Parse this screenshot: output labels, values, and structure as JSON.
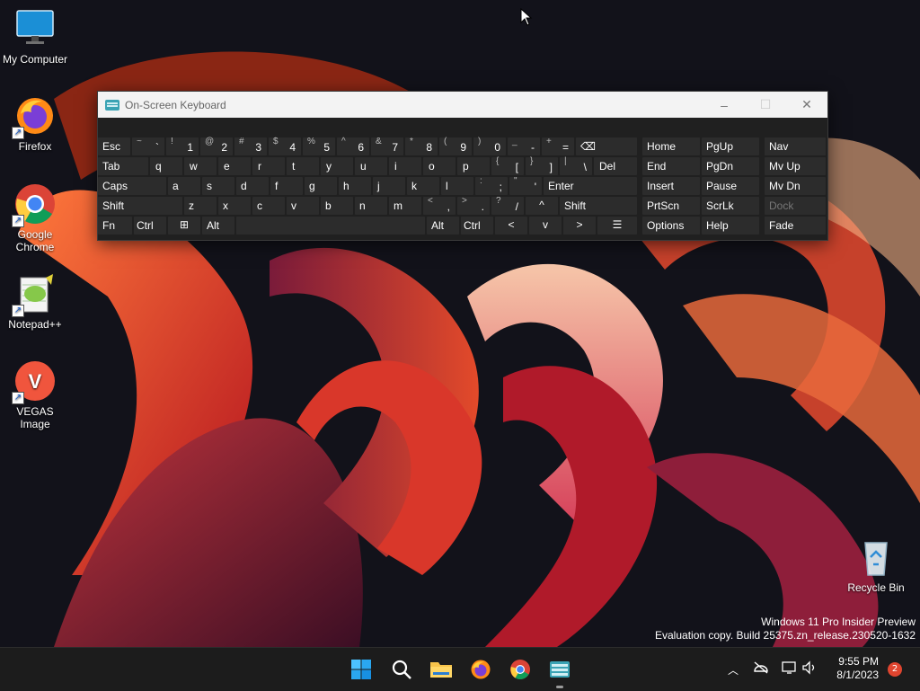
{
  "desktop": {
    "icons": [
      {
        "label": "My Computer",
        "icon": "monitor-icon"
      },
      {
        "label": "Firefox",
        "icon": "firefox-icon"
      },
      {
        "label": "Google Chrome",
        "icon": "chrome-icon"
      },
      {
        "label": "Notepad++",
        "icon": "notepadpp-icon"
      },
      {
        "label": "VEGAS Image",
        "icon": "vegas-icon"
      },
      {
        "label": "Recycle Bin",
        "icon": "recycle-bin-icon"
      }
    ],
    "watermark": {
      "line1": "Windows 11 Pro Insider Preview",
      "line2": "Evaluation copy. Build 25375.zn_release.230520-1632"
    }
  },
  "osk": {
    "title": "On-Screen Keyboard",
    "controls": {
      "minimize": "–",
      "maximize": "☐",
      "close": "✕"
    },
    "rows": [
      [
        {
          "main": "Esc"
        },
        {
          "shift": "~",
          "main": "`"
        },
        {
          "shift": "!",
          "main": "1"
        },
        {
          "shift": "@",
          "main": "2"
        },
        {
          "shift": "#",
          "main": "3"
        },
        {
          "shift": "$",
          "main": "4"
        },
        {
          "shift": "%",
          "main": "5"
        },
        {
          "shift": "^",
          "main": "6"
        },
        {
          "shift": "&",
          "main": "7"
        },
        {
          "shift": "*",
          "main": "8"
        },
        {
          "shift": "(",
          "main": "9"
        },
        {
          "shift": ")",
          "main": "0"
        },
        {
          "shift": "_",
          "main": "-"
        },
        {
          "shift": "+",
          "main": "="
        },
        {
          "main": "⌫"
        },
        {
          "main": "Home"
        },
        {
          "main": "PgUp"
        },
        {
          "main": "Nav"
        }
      ],
      [
        {
          "main": "Tab"
        },
        {
          "main": "q"
        },
        {
          "main": "w"
        },
        {
          "main": "e"
        },
        {
          "main": "r"
        },
        {
          "main": "t"
        },
        {
          "main": "y"
        },
        {
          "main": "u"
        },
        {
          "main": "i"
        },
        {
          "main": "o"
        },
        {
          "main": "p"
        },
        {
          "shift": "{",
          "main": "["
        },
        {
          "shift": "}",
          "main": "]"
        },
        {
          "shift": "|",
          "main": "\\"
        },
        {
          "main": "Del"
        },
        {
          "main": "End"
        },
        {
          "main": "PgDn"
        },
        {
          "main": "Mv Up"
        }
      ],
      [
        {
          "main": "Caps"
        },
        {
          "main": "a"
        },
        {
          "main": "s"
        },
        {
          "main": "d"
        },
        {
          "main": "f"
        },
        {
          "main": "g"
        },
        {
          "main": "h"
        },
        {
          "main": "j"
        },
        {
          "main": "k"
        },
        {
          "main": "l"
        },
        {
          "shift": ":",
          "main": ";"
        },
        {
          "shift": "\"",
          "main": "'"
        },
        {
          "main": "Enter"
        },
        {
          "main": "Insert"
        },
        {
          "main": "Pause"
        },
        {
          "main": "Mv Dn"
        }
      ],
      [
        {
          "main": "Shift"
        },
        {
          "main": "z"
        },
        {
          "main": "x"
        },
        {
          "main": "c"
        },
        {
          "main": "v"
        },
        {
          "main": "b"
        },
        {
          "main": "n"
        },
        {
          "main": "m"
        },
        {
          "shift": "<",
          "main": ","
        },
        {
          "shift": ">",
          "main": "."
        },
        {
          "shift": "?",
          "main": "/"
        },
        {
          "main": "^"
        },
        {
          "main": "Shift"
        },
        {
          "main": "PrtScn"
        },
        {
          "main": "ScrLk"
        },
        {
          "main": "Dock"
        }
      ],
      [
        {
          "main": "Fn"
        },
        {
          "main": "Ctrl"
        },
        {
          "main": "⊞"
        },
        {
          "main": "Alt"
        },
        {
          "main": ""
        },
        {
          "main": "Alt"
        },
        {
          "main": "Ctrl"
        },
        {
          "main": "<"
        },
        {
          "main": "v"
        },
        {
          "main": ">"
        },
        {
          "main": "☰"
        },
        {
          "main": "Options"
        },
        {
          "main": "Help"
        },
        {
          "main": "Fade"
        }
      ]
    ]
  },
  "taskbar": {
    "apps": [
      "start-icon",
      "search-icon",
      "file-explorer-icon",
      "firefox-icon",
      "chrome-icon",
      "osk-icon"
    ],
    "tray": {
      "time": "9:55 PM",
      "date": "8/1/2023",
      "notification_count": "2"
    }
  }
}
